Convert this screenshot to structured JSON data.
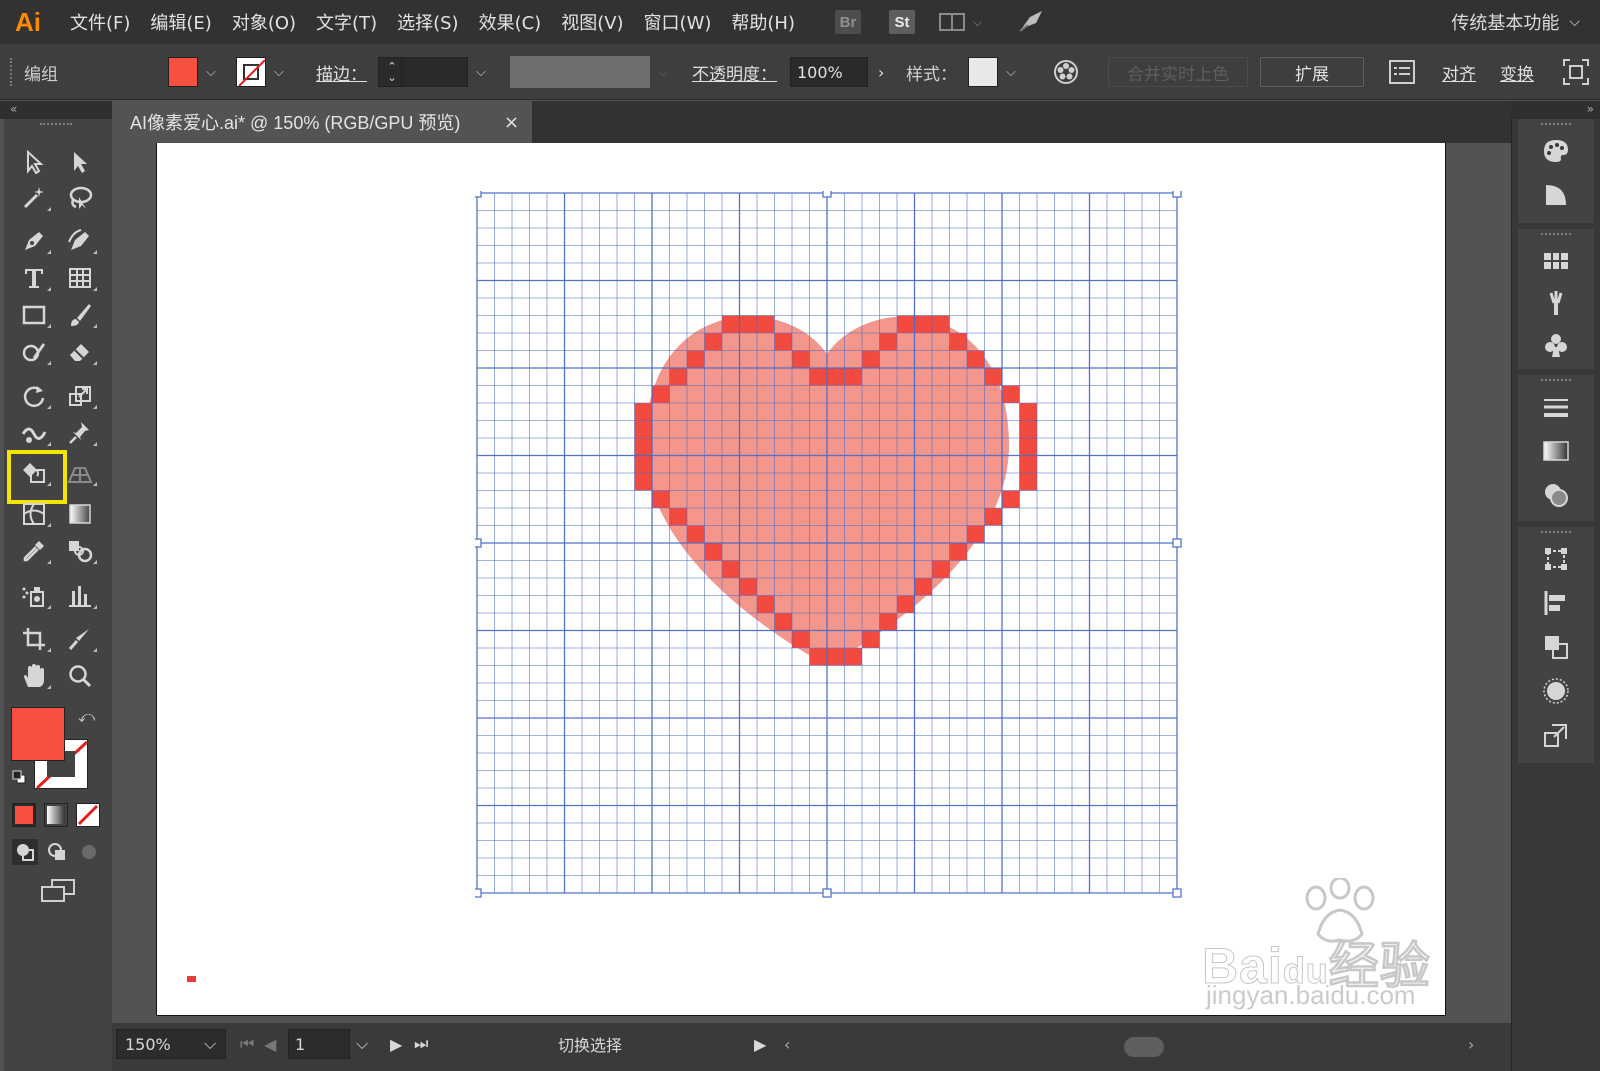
{
  "app": {
    "logo": "Ai",
    "menu": [
      "文件(F)",
      "编辑(E)",
      "对象(O)",
      "文字(T)",
      "选择(S)",
      "效果(C)",
      "视图(V)",
      "窗口(W)",
      "帮助(H)"
    ],
    "bridge_label": "Br",
    "stock_label": "St",
    "workspace": "传统基本功能"
  },
  "control_bar": {
    "selection_type": "编组",
    "fill_color": "#f85040",
    "stroke_label": "描边：",
    "opacity_label": "不透明度：",
    "opacity_value": "100%",
    "style_label": "样式：",
    "live_paint_button": "合并实时上色",
    "expand_button": "扩展",
    "align_link": "对齐",
    "transform_link": "变换"
  },
  "document": {
    "tab_title": "AI像素爱心.ai* @ 150% (RGB/GPU 预览)",
    "close_glyph": "×"
  },
  "toolbar": {
    "fill_color": "#f85040",
    "highlighted_tool": "live-paint-bucket-tool",
    "highlight_color": "#f5e400"
  },
  "canvas": {
    "grid_color": "#4a6cc8",
    "pixel_color": "#f24a3e",
    "heart_color": "#f4968c"
  },
  "status_bar": {
    "zoom": "150%",
    "artboard_number": "1",
    "status_text": "切换选择"
  },
  "watermark": {
    "brand_prefix": "Bai",
    "brand_mid": "du",
    "brand_suffix": "经验",
    "url": "jingyan.baidu.com"
  }
}
